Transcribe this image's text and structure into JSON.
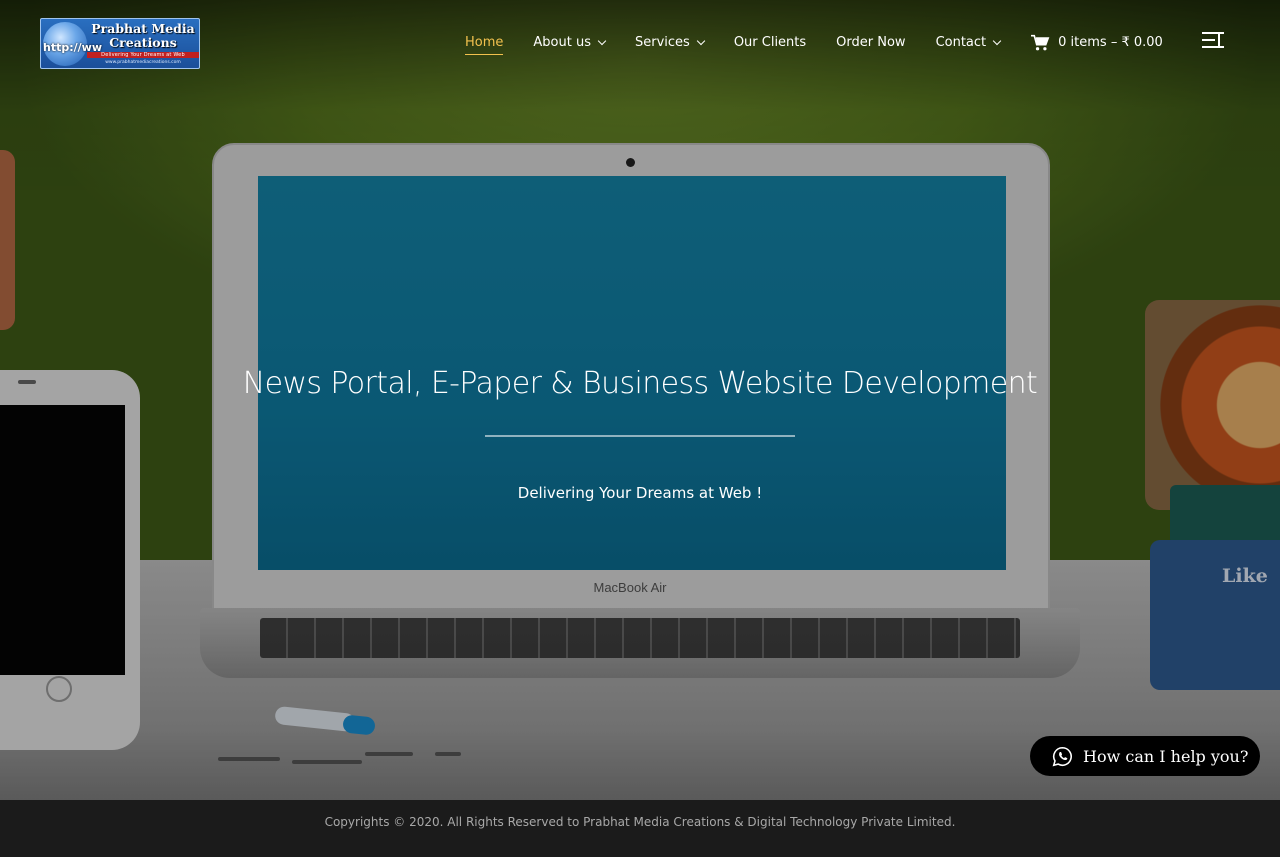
{
  "brand": {
    "logo_title_line1": "Prabhat Media",
    "logo_title_line2": "Creations",
    "logo_http": "http://ww",
    "logo_tagline": "Delivering Your Dreams at Web",
    "logo_url": "www.prabhatmediacreations.com"
  },
  "nav": {
    "items": [
      {
        "label": "Home",
        "active": true,
        "has_dropdown": false
      },
      {
        "label": "About us",
        "active": false,
        "has_dropdown": true
      },
      {
        "label": "Services",
        "active": false,
        "has_dropdown": true
      },
      {
        "label": "Our Clients",
        "active": false,
        "has_dropdown": false
      },
      {
        "label": "Order Now",
        "active": false,
        "has_dropdown": false
      },
      {
        "label": "Contact",
        "active": false,
        "has_dropdown": true
      }
    ],
    "cart_label": "0 items – ₹ 0.00",
    "accent_color": "#f2c14e"
  },
  "hero": {
    "title": "News Portal, E-Paper & Business Website Development",
    "subtitle": "Delivering Your Dreams at Web !",
    "laptop_brand": "MacBook Air",
    "block_text": "Like"
  },
  "help_button": {
    "label": "How can I help you?",
    "icon": "whatsapp-icon"
  },
  "footer": {
    "copyright": "Copyrights © 2020. All Rights Reserved to Prabhat Media Creations & Digital Technology Private Limited."
  }
}
